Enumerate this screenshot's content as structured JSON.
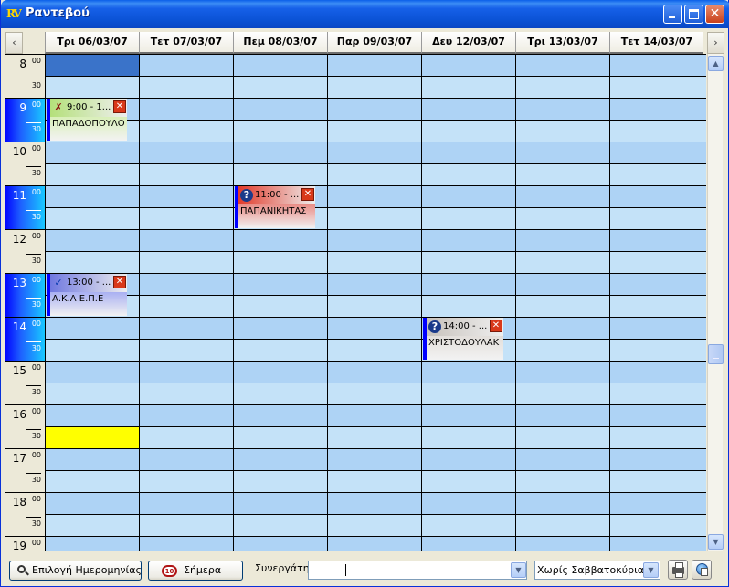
{
  "window": {
    "title": "Ραντεβού",
    "icon_text": "RV"
  },
  "header": {
    "prev_icon": "chevron-left-icon",
    "next_icon": "chevron-right-icon",
    "days": [
      "Τρι 06/03/07",
      "Τετ 07/03/07",
      "Πεμ 08/03/07",
      "Παρ 09/03/07",
      "Δευ 12/03/07",
      "Τρι 13/03/07",
      "Τετ 14/03/07"
    ]
  },
  "times": {
    "hours": [
      "8",
      "9",
      "10",
      "11",
      "12",
      "13",
      "14",
      "15",
      "16",
      "17",
      "18",
      "19"
    ],
    "minute_top": "00",
    "minute_half": "30"
  },
  "appointments": [
    {
      "day": "Τρι 06/03/07",
      "time": "9:00 - 1...",
      "name": "ΠΑΠΑΔΟΠΟΥΛΟ",
      "status_icon": "cancelled-x-icon",
      "header_color": "#B4E07A",
      "body_color": "#D8EFB8"
    },
    {
      "day": "Πεμ 08/03/07",
      "time": "11:00 - ...",
      "name": "ΠΑΠΑΝΙΚΗΤΑΣ",
      "status_icon": "question-icon",
      "header_color": "#E23A2A",
      "body_color": "#E88C86"
    },
    {
      "day": "Τρι 06/03/07",
      "time": "13:00 - ...",
      "name": "Α.Κ.Λ Ε.Π.Ε",
      "status_icon": "check-icon",
      "header_color": "#6F78E0",
      "body_color": "#A9B0F2"
    },
    {
      "day": "Δευ 12/03/07",
      "time": "14:00 - ...",
      "name": "ΧΡΙΣΤΟΔΟΥΛΑΚ",
      "status_icon": "question-icon",
      "header_color": "#C8C2BC",
      "body_color": "#E2DEDA"
    }
  ],
  "bottom": {
    "select_date_label": "Επιλογή Ημερομηνίας",
    "today_label": "Σήμερα",
    "today_icon_text": "10",
    "partner_label": "Συνεργάτης",
    "partner_value": "",
    "weekend_value": "Χωρίς Σαββατοκύριακο"
  },
  "colors": {
    "cell": "#C6E3FA",
    "selected_cell": "#3A73C9",
    "highlight_cell": "#FFFF00",
    "appointment_border": "#0000FF"
  }
}
